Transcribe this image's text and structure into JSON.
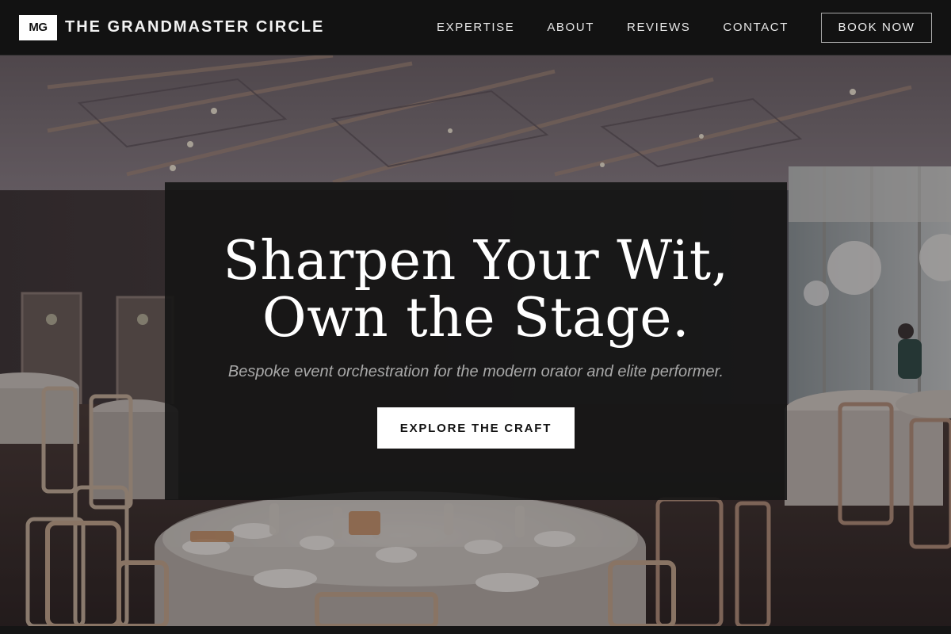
{
  "brand": {
    "logo_text": "MG",
    "name": "THE GRANDMASTER CIRCLE"
  },
  "nav": {
    "links": [
      {
        "label": "EXPERTISE"
      },
      {
        "label": "ABOUT"
      },
      {
        "label": "REVIEWS"
      },
      {
        "label": "CONTACT"
      }
    ],
    "cta_label": "BOOK NOW"
  },
  "hero": {
    "title_line1": "Sharpen Your Wit,",
    "title_line2": "Own the Stage.",
    "subtitle": "Bespoke event orchestration for the modern orator and elite performer.",
    "cta_label": "EXPLORE THE CRAFT",
    "background_image": "banquet-hall-photo"
  },
  "colors": {
    "nav_background": "#121212",
    "card_background": "#161616",
    "text_primary": "#ffffff",
    "text_muted": "#a8a8a8",
    "button_background": "#ffffff"
  }
}
